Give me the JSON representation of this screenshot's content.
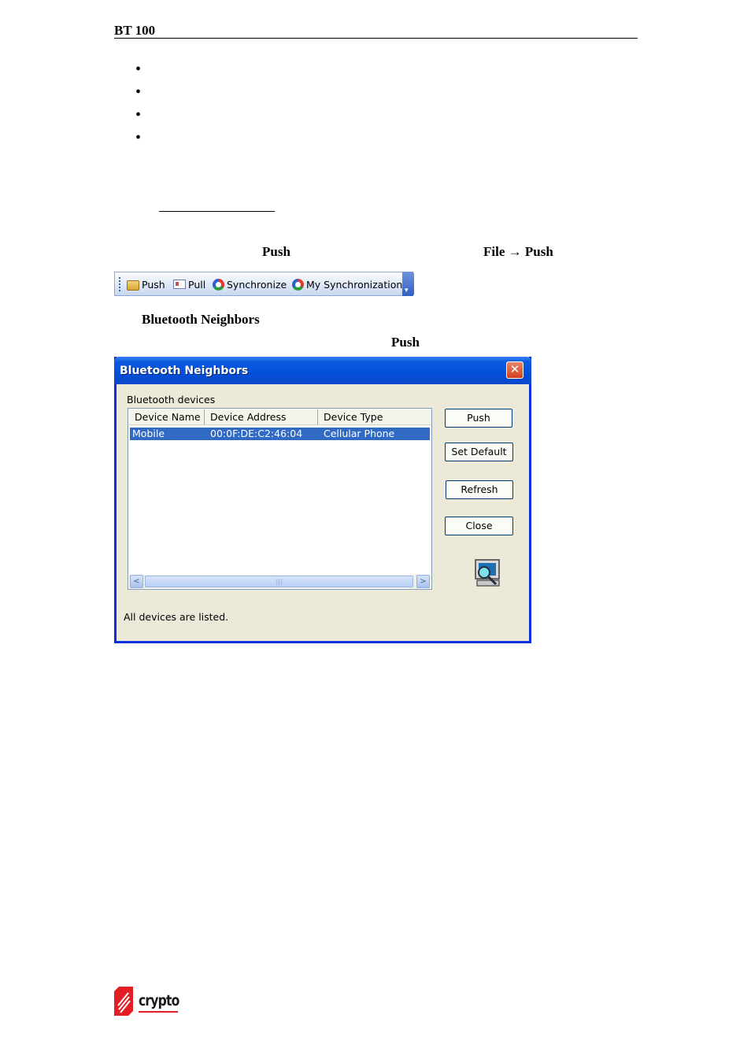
{
  "header": {
    "title": "BT 100"
  },
  "bullets": [
    "",
    "",
    "",
    ""
  ],
  "body": {
    "push_word": "Push",
    "menu_path": "File → Push",
    "dialog_name": "Bluetooth Neighbors",
    "push_word_2": "Push"
  },
  "toolbar": {
    "items": [
      {
        "label": "Push",
        "icon": "push-folder-icon"
      },
      {
        "label": "Pull",
        "icon": "pull-card-icon"
      },
      {
        "label": "Synchronize",
        "icon": "sync-icon"
      },
      {
        "label": "My Synchronization",
        "icon": "my-sync-icon"
      }
    ],
    "overflow_glyph": "▾"
  },
  "dialog": {
    "title": "Bluetooth Neighbors",
    "close_glyph": "✕",
    "group_label": "Bluetooth devices",
    "columns": [
      "Device Name",
      "Device Address",
      "Device Type"
    ],
    "rows": [
      {
        "name": "Mobile",
        "address": "00:0F:DE:C2:46:04",
        "type": "Cellular Phone",
        "selected": true
      }
    ],
    "buttons": {
      "push": "Push",
      "set_default": "Set Default",
      "refresh": "Refresh",
      "close": "Close"
    },
    "scroll": {
      "left": "<",
      "right": ">",
      "thumb": "|||"
    },
    "status": "All devices are listed."
  },
  "footer": {
    "logo_text": "crypto",
    "brand_color": "#e31e24"
  },
  "colors": {
    "title_bar": "#0350d8",
    "selection": "#316ac5",
    "dialog_bg": "#ece9d8"
  }
}
